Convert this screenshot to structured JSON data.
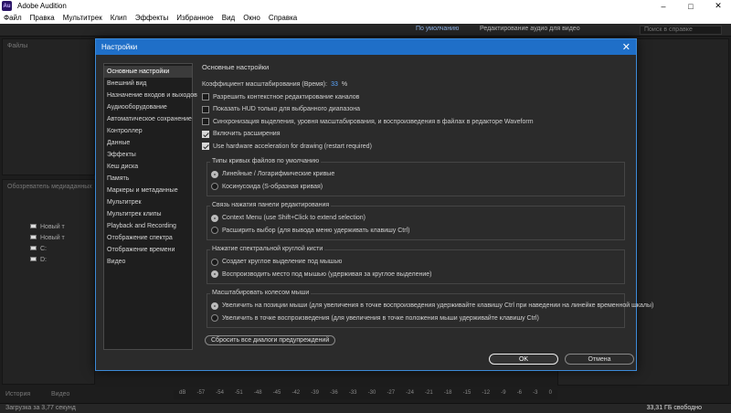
{
  "window": {
    "title": "Adobe Audition",
    "app_icon": "Au"
  },
  "menu": [
    "Файл",
    "Правка",
    "Мультитрек",
    "Клип",
    "Эффекты",
    "Избранное",
    "Вид",
    "Окно",
    "Справка"
  ],
  "toolbar": {
    "workspace_default": "По умолчанию",
    "workspace_edit_audio": "Редактирование аудио для видео",
    "search_placeholder": "Поиск в справке"
  },
  "background": {
    "files_tab": "Файлы",
    "media_tab": "Обозреватель медиаданных",
    "tree": [
      "Новый т",
      "Новый т",
      "C:",
      "D:"
    ],
    "status_text": "Загрузка за 3,77 секунд",
    "free_space": "33,31 ГБ свободно",
    "history_tab": "История",
    "video_tab": "Видео",
    "ruler": [
      "dB",
      "-57",
      "-54",
      "-51",
      "-48",
      "-45",
      "-42",
      "-39",
      "-36",
      "-33",
      "-30",
      "-27",
      "-24",
      "-21",
      "-18",
      "-15",
      "-12",
      "-9",
      "-6",
      "-3",
      "0"
    ]
  },
  "dialog": {
    "title": "Настройки",
    "categories": [
      "Основные настройки",
      "Внешний вид",
      "Назначение входов и выходов",
      "Аудиооборудование",
      "Автоматическое сохранение",
      "Контроллер",
      "Данные",
      "Эффекты",
      "Кеш диска",
      "Память",
      "Маркеры и метаданные",
      "Мультитрек",
      "Мультитрек клипы",
      "Playback and Recording",
      "Отображение спектра",
      "Отображение времени",
      "Видео"
    ],
    "section_title": "Основные настройки",
    "scale_label": "Коэффициент масштабирования (Время):",
    "scale_value": "33",
    "scale_unit": "%",
    "checkboxes": [
      {
        "label": "Разрешить контекстное редактирование каналов",
        "checked": false
      },
      {
        "label": "Показать HUD только для выбранного диапазона",
        "checked": false
      },
      {
        "label": "Синхронизация выделения, уровня масштабирования, и воспроизведения в файлах в редакторе Waveform",
        "checked": false
      },
      {
        "label": "Включить расширения",
        "checked": true
      },
      {
        "label": "Use hardware acceleration for drawing (restart required)",
        "checked": true
      }
    ],
    "groups": [
      {
        "title": "Типы кривых файлов по умолчанию",
        "options": [
          "Линейные / Логарифмические кривые",
          "Косинусоида (S-образная кривая)"
        ],
        "selected": 0
      },
      {
        "title": "Связь нажатия панели редактирования",
        "options": [
          "Context Menu (use Shift+Click to extend selection)",
          "Расширить выбор (для вывода меню удерживать клавишу Ctrl)"
        ],
        "selected": 0
      },
      {
        "title": "Нажатие спектральной круглой кисти",
        "options": [
          "Создает круглое выделение под мышью",
          "Воспроизводить место под мышью (удерживая за круглое выделение)"
        ],
        "selected": 1
      },
      {
        "title": "Масштабировать колесом мыши",
        "options": [
          "Увеличить на позиции мыши (для увеличения в точке воспроизведения удерживайте клавишу Ctrl при наведении на линейке временной шкалы)",
          "Увеличить в точке воспроизведения (для увеличения в точке положения мыши удерживайте клавишу Ctrl)"
        ],
        "selected": 0
      }
    ],
    "reset_button": "Сбросить все диалоги предупреждений",
    "ok_button": "OK",
    "cancel_button": "Отмена"
  }
}
